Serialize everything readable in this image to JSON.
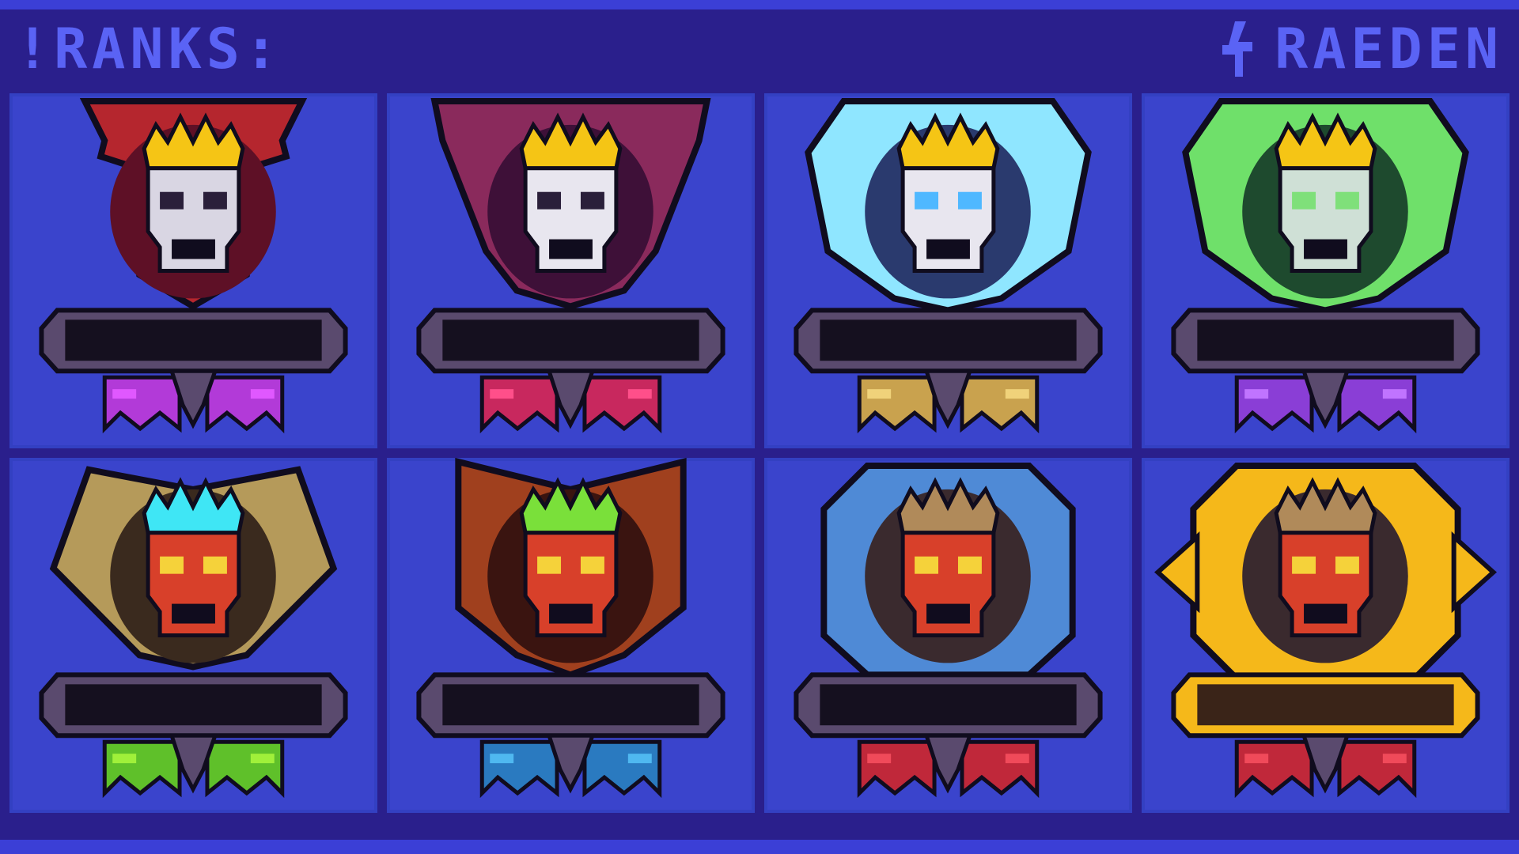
{
  "header": {
    "title": "!RANKS:",
    "author": "RAEDEN",
    "author_icon": "lightning-bolt-icon"
  },
  "colors": {
    "background": "#2a1f8c",
    "frame": "#3b3fd6",
    "cell": "#3a44cc",
    "title_text": "#5a63f5"
  },
  "badges": [
    {
      "name": "bronze-skull-badge",
      "frame": "#b5262e",
      "frame_dark": "#5e1026",
      "crown": "#f5c515",
      "eyes": "#2a1f3a",
      "skull": "#d9d6e3",
      "ribbon": "#b23ad8",
      "ribbon_light": "#e058ff",
      "shape": "banner"
    },
    {
      "name": "silver-skull-badge",
      "frame": "#8a2a5c",
      "frame_dark": "#3e1038",
      "crown": "#f5c515",
      "eyes": "#2a1f3a",
      "skull": "#e8e6ef",
      "ribbon": "#c8285e",
      "ribbon_light": "#ff4f8a",
      "shape": "triangle"
    },
    {
      "name": "gold-skull-badge",
      "frame": "#8fe6ff",
      "frame_dark": "#2a3a6e",
      "crown": "#f5c515",
      "eyes": "#4fb8ff",
      "skull": "#e8e6ef",
      "ribbon": "#c9a24e",
      "ribbon_light": "#f0d27a",
      "shape": "hexagon"
    },
    {
      "name": "platinum-skull-badge",
      "frame": "#6fe06a",
      "frame_dark": "#1e4a2e",
      "crown": "#f5c515",
      "eyes": "#7fe07a",
      "skull": "#cfe0d6",
      "ribbon": "#8a3ed6",
      "ribbon_light": "#c074ff",
      "shape": "hexagon"
    },
    {
      "name": "diamond-demon-badge",
      "frame": "#b59a5a",
      "frame_dark": "#3a2a1e",
      "crown": "#3fe6f5",
      "eyes": "#f5d23a",
      "skull": "#d8402a",
      "ribbon": "#5fc02a",
      "ribbon_light": "#a0f03a",
      "shape": "diamond"
    },
    {
      "name": "master-demon-badge",
      "frame": "#a0401e",
      "frame_dark": "#3a1410",
      "crown": "#7ae03a",
      "eyes": "#f5d23a",
      "skull": "#d8402a",
      "ribbon": "#2a7ac0",
      "ribbon_light": "#4fb8f0",
      "shape": "shield"
    },
    {
      "name": "grandmaster-demon-badge",
      "frame": "#4f8ad6",
      "frame_dark": "#3a2a2e",
      "crown": "#b08a5a",
      "eyes": "#f5d23a",
      "skull": "#d8402a",
      "ribbon": "#c0283a",
      "ribbon_light": "#f04a5a",
      "shape": "octagon"
    },
    {
      "name": "legend-demon-badge",
      "frame": "#f5b81a",
      "frame_dark": "#3a2a2e",
      "crown": "#b08a5a",
      "eyes": "#f5d23a",
      "skull": "#d8402a",
      "ribbon": "#c0283a",
      "ribbon_light": "#f04a5a",
      "shape": "octagon-gold"
    }
  ]
}
